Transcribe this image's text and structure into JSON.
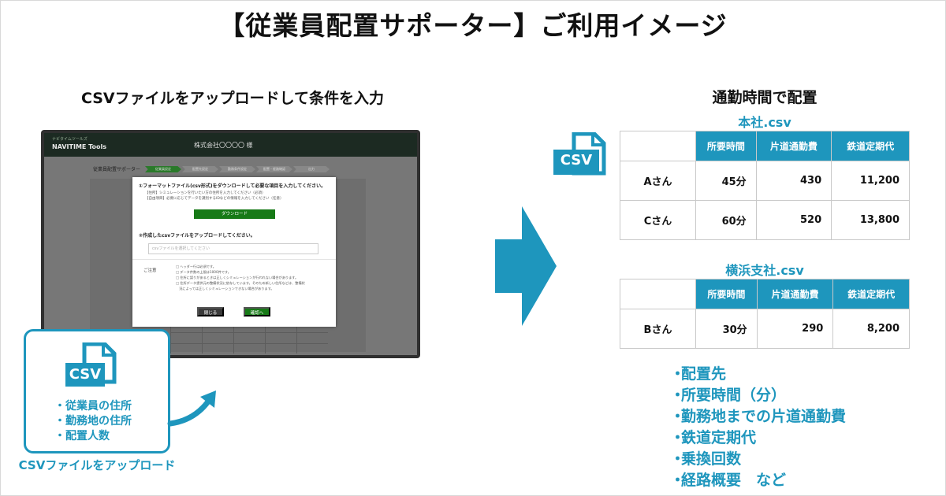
{
  "title": "【従業員配置サポーター】ご利用イメージ",
  "left_heading": "CSVファイルをアップロードして条件を入力",
  "right_heading": "通勤時間で配置",
  "screenshot": {
    "brand_small": "ナビタイムツールズ",
    "brand": "NAVITIME Tools",
    "company": "株式会社〇〇〇〇 様",
    "app_name": "従業員配置サポーター",
    "steps": [
      "従業員設定",
      "配置先設定",
      "勤務条件設定",
      "配置・経路確認",
      "出力"
    ],
    "modal": {
      "q1": "①フォーマットファイル(csv形式)をダウンロードして必要な項目を入力してください。",
      "note_required": "【住所】シミュレーションを行いたい方の住所を入力してください（必須）",
      "note_optional": "【自由項目】必要に応じてデータを識別するIDなどの情報を入力してください（任意）",
      "download_label": "ダウンロード",
      "q2": "②作成したcsvファイルをアップロードしてください。",
      "input_placeholder": "csvファイルを選択してください",
      "notice_label": "ご注意",
      "notes": [
        "□ ヘッダー行は必須です。",
        "□ データ件数の上限は1000件です。",
        "□ 住所に誤りがあるときは正しくシミュレーションが行われない場合があります。",
        "□ 住所データ提供元の整備状況に依存しています。そのため新しい住所などは、整備状",
        "　況によっては正しくシミュレーションできない場合があります。"
      ],
      "close_label": "閉じる",
      "next_label": "確認へ"
    }
  },
  "csv_card": {
    "icon_label": "CSV",
    "items": [
      "・従業員の住所",
      "・勤務地の住所",
      "・配置人数"
    ],
    "caption": "CSVファイルをアップロード"
  },
  "csv_icon_right": "CSV",
  "tables": [
    {
      "title": "本社.csv",
      "headers": [
        "所要時間",
        "片道通勤費",
        "鉄道定期代"
      ],
      "rows": [
        {
          "name": "Aさん",
          "cells": [
            "45分",
            "430",
            "11,200"
          ]
        },
        {
          "name": "Cさん",
          "cells": [
            "60分",
            "520",
            "13,800"
          ]
        }
      ]
    },
    {
      "title": "横浜支社.csv",
      "headers": [
        "所要時間",
        "片道通勤費",
        "鉄道定期代"
      ],
      "rows": [
        {
          "name": "Bさん",
          "cells": [
            "30分",
            "290",
            "8,200"
          ]
        }
      ]
    }
  ],
  "output_items": [
    "配置先",
    "所要時間（分）",
    "勤務地までの片道通勤費",
    "鉄道定期代",
    "乗換回数",
    "経路概要　など"
  ],
  "colors": {
    "accent": "#1e96bd",
    "green": "#177a17"
  }
}
